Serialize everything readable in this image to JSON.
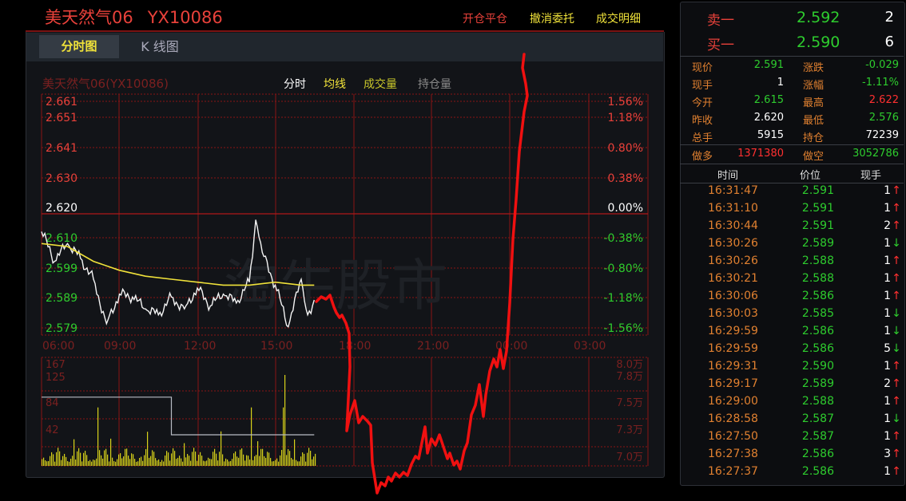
{
  "header": {
    "name": "美天然气06",
    "symbol": "YX10086",
    "link_open_close": "开仓平仓",
    "link_cancel": "撤消委托",
    "link_deals": "成交明细"
  },
  "tabs": {
    "intraday": "分时图",
    "kline": "K 线图"
  },
  "chart_header": {
    "name": "美天然气06(YX10086)",
    "tab_intraday": "分时",
    "tab_avg": "均线",
    "tab_volume": "成交量",
    "tab_oi": "持仓量"
  },
  "watermark": "淘牛股市",
  "colors": {
    "up": "#ff3030",
    "down": "#2ecc2e",
    "avg_line": "#f0e23a",
    "volume": "#d8d21a",
    "grid": "#8a1414"
  },
  "chart_data": {
    "type": "line",
    "title": "",
    "prev_close": 2.62,
    "y_ticks": [
      "2.661",
      "2.651",
      "2.641",
      "2.630",
      "2.620",
      "2.610",
      "2.599",
      "2.589",
      "2.579"
    ],
    "pct_ticks": [
      "1.56%",
      "1.18%",
      "0.80%",
      "0.38%",
      "0.00%",
      "-0.38%",
      "-0.80%",
      "-1.18%",
      "-1.56%"
    ],
    "x_ticks": [
      "06:00",
      "09:00",
      "12:00",
      "15:00",
      "18:00",
      "21:00",
      "00:00",
      "03:00"
    ],
    "ylim": [
      2.579,
      2.661
    ],
    "series": [
      {
        "name": "分时",
        "x": [
          "06:00",
          "06:30",
          "07:00",
          "07:30",
          "08:00",
          "08:30",
          "09:00",
          "09:30",
          "10:00",
          "10:30",
          "11:00",
          "11:30",
          "12:00",
          "12:30",
          "13:00",
          "13:30",
          "14:00",
          "14:15",
          "14:30",
          "15:00",
          "15:30",
          "16:00",
          "16:15",
          "16:30"
        ],
        "values": [
          2.614,
          2.604,
          2.61,
          2.605,
          2.598,
          2.583,
          2.593,
          2.592,
          2.588,
          2.586,
          2.592,
          2.588,
          2.595,
          2.589,
          2.593,
          2.59,
          2.597,
          2.618,
          2.607,
          2.596,
          2.582,
          2.598,
          2.586,
          2.591
        ]
      },
      {
        "name": "均线",
        "x": [
          "06:00",
          "07:00",
          "08:00",
          "09:00",
          "10:00",
          "11:00",
          "12:00",
          "13:00",
          "14:00",
          "15:00",
          "16:00",
          "16:30"
        ],
        "values": [
          2.61,
          2.609,
          2.604,
          2.601,
          2.599,
          2.598,
          2.597,
          2.596,
          2.596,
          2.597,
          2.596,
          2.596
        ]
      }
    ],
    "volume": {
      "y_ticks": [
        "167",
        "125",
        "84",
        "42"
      ],
      "right_ticks": [
        "8.0万",
        "7.8万",
        "7.5万",
        "7.3万",
        "7.0万"
      ],
      "oi_line": [
        {
          "x": "06:00",
          "value": 7.55
        },
        {
          "x": "11:00",
          "value": 7.55
        },
        {
          "x": "11:00",
          "value": 7.2
        },
        {
          "x": "16:30",
          "value": 7.2
        }
      ]
    }
  },
  "orderbook": {
    "ask": {
      "label": "卖一",
      "price": "2.592",
      "volume": "2"
    },
    "bid": {
      "label": "买一",
      "price": "2.590",
      "volume": "6"
    }
  },
  "quote": [
    {
      "k1": "现价",
      "v1": "2.591",
      "c1": "green",
      "k2": "涨跌",
      "v2": "-0.029",
      "c2": "green"
    },
    {
      "k1": "现手",
      "v1": "1",
      "c1": "white",
      "k2": "涨幅",
      "v2": "-1.11%",
      "c2": "green"
    },
    {
      "k1": "今开",
      "v1": "2.615",
      "c1": "green",
      "k2": "最高",
      "v2": "2.622",
      "c2": "red"
    },
    {
      "k1": "昨收",
      "v1": "2.620",
      "c1": "white",
      "k2": "最低",
      "v2": "2.576",
      "c2": "green"
    },
    {
      "k1": "总手",
      "v1": "5915",
      "c1": "white",
      "k2": "持仓",
      "v2": "72239",
      "c2": "white"
    }
  ],
  "long_short": {
    "k1": "做多",
    "v1": "1371380",
    "k2": "做空",
    "v2": "3052786"
  },
  "ticks_header": {
    "time": "时间",
    "price": "价位",
    "vol": "现手"
  },
  "ticks": [
    {
      "time": "16:31:47",
      "price": "2.591",
      "vol": "1",
      "dir": "up"
    },
    {
      "time": "16:31:10",
      "price": "2.591",
      "vol": "1",
      "dir": "up"
    },
    {
      "time": "16:30:44",
      "price": "2.591",
      "vol": "2",
      "dir": "up"
    },
    {
      "time": "16:30:26",
      "price": "2.589",
      "vol": "1",
      "dir": "down"
    },
    {
      "time": "16:30:26",
      "price": "2.588",
      "vol": "1",
      "dir": "up"
    },
    {
      "time": "16:30:21",
      "price": "2.588",
      "vol": "1",
      "dir": "up"
    },
    {
      "time": "16:30:06",
      "price": "2.586",
      "vol": "1",
      "dir": "up"
    },
    {
      "time": "16:30:03",
      "price": "2.585",
      "vol": "1",
      "dir": "down"
    },
    {
      "time": "16:29:59",
      "price": "2.586",
      "vol": "1",
      "dir": "down"
    },
    {
      "time": "16:29:59",
      "price": "2.586",
      "vol": "5",
      "dir": "down"
    },
    {
      "time": "16:29:31",
      "price": "2.590",
      "vol": "1",
      "dir": "up"
    },
    {
      "time": "16:29:17",
      "price": "2.589",
      "vol": "2",
      "dir": "up"
    },
    {
      "time": "16:29:00",
      "price": "2.588",
      "vol": "1",
      "dir": "up"
    },
    {
      "time": "16:28:58",
      "price": "2.587",
      "vol": "1",
      "dir": "down"
    },
    {
      "time": "16:27:50",
      "price": "2.587",
      "vol": "1",
      "dir": "up"
    },
    {
      "time": "16:27:38",
      "price": "2.586",
      "vol": "3",
      "dir": "up"
    },
    {
      "time": "16:27:37",
      "price": "2.586",
      "vol": "1",
      "dir": "up"
    }
  ]
}
